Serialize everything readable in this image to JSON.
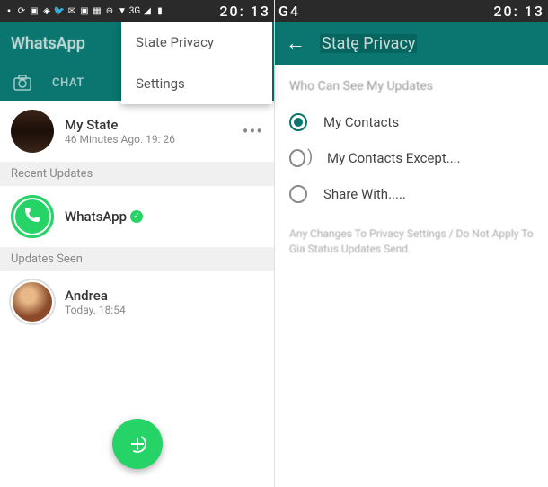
{
  "statusBar": {
    "time1": "20: 13",
    "g4": "G4",
    "time2": "20: 13"
  },
  "left": {
    "appTitle": "WhatsApp",
    "tabs": {
      "chat": "CHAT"
    },
    "popup": {
      "item1": "State Privacy",
      "item2": "Settings"
    },
    "myState": {
      "name": "My State",
      "time": "46 Minutes Ago. 19: 26"
    },
    "sections": {
      "recent": "Recent Updates",
      "seen": "Updates Seen"
    },
    "whatsapp": {
      "name": "WhatsApp"
    },
    "andrea": {
      "name": "Andrea",
      "time": "Today. 18:54"
    }
  },
  "right": {
    "title": "Statę Privacy",
    "sectionTitle": "Who Can See My Updates",
    "options": {
      "opt1": "My Contacts",
      "opt2": "My Contacts Except....",
      "opt3": "Share With....."
    },
    "note": "Any Changes To Privacy Settings / Do Not Apply To Gia Status Updates Send."
  }
}
